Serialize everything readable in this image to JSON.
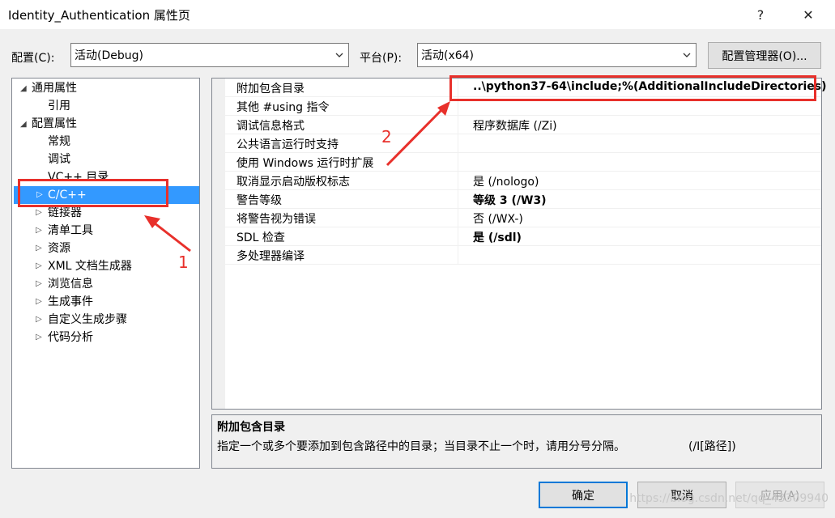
{
  "window": {
    "title": "Identity_Authentication 属性页",
    "help_icon": "?",
    "close_icon": "✕"
  },
  "toolbar": {
    "config_label": "配置(C):",
    "config_value": "活动(Debug)",
    "platform_label": "平台(P):",
    "platform_value": "活动(x64)",
    "config_manager_label": "配置管理器(O)..."
  },
  "tree": {
    "items": [
      {
        "label": "通用属性",
        "glyph": "◢"
      },
      {
        "label": "引用"
      },
      {
        "label": "配置属性",
        "glyph": "◢"
      },
      {
        "label": "常规"
      },
      {
        "label": "调试"
      },
      {
        "label": "VC++ 目录"
      },
      {
        "label": "C/C++",
        "glyph": "▷"
      },
      {
        "label": "链接器",
        "glyph": "▷"
      },
      {
        "label": "清单工具",
        "glyph": "▷"
      },
      {
        "label": "资源",
        "glyph": "▷"
      },
      {
        "label": "XML 文档生成器",
        "glyph": "▷"
      },
      {
        "label": "浏览信息",
        "glyph": "▷"
      },
      {
        "label": "生成事件",
        "glyph": "▷"
      },
      {
        "label": "自定义生成步骤",
        "glyph": "▷"
      },
      {
        "label": "代码分析",
        "glyph": "▷"
      }
    ]
  },
  "grid": {
    "rows": [
      {
        "name": "附加包含目录",
        "value": "..\\python37-64\\include;%(AdditionalIncludeDirectories)"
      },
      {
        "name": "其他 #using 指令",
        "value": ""
      },
      {
        "name": "调试信息格式",
        "value": "程序数据库 (/Zi)"
      },
      {
        "name": "公共语言运行时支持",
        "value": ""
      },
      {
        "name": "使用 Windows 运行时扩展",
        "value": ""
      },
      {
        "name": "取消显示启动版权标志",
        "value": "是 (/nologo)"
      },
      {
        "name": "警告等级",
        "value": "等级 3 (/W3)"
      },
      {
        "name": "将警告视为错误",
        "value": "否 (/WX-)"
      },
      {
        "name": "SDL 检查",
        "value": "是 (/sdl)"
      },
      {
        "name": "多处理器编译",
        "value": ""
      }
    ]
  },
  "description": {
    "title": "附加包含目录",
    "text": "指定一个或多个要添加到包含路径中的目录；当目录不止一个时，请用分号分隔。",
    "switch": "(/I[路径])"
  },
  "buttons": {
    "ok": "确定",
    "cancel": "取消",
    "apply": "应用(A)"
  },
  "annotations": {
    "num1": "1",
    "num2": "2",
    "color": "#e8302b"
  },
  "watermark": "https://blog.csdn.net/qq_43309940"
}
